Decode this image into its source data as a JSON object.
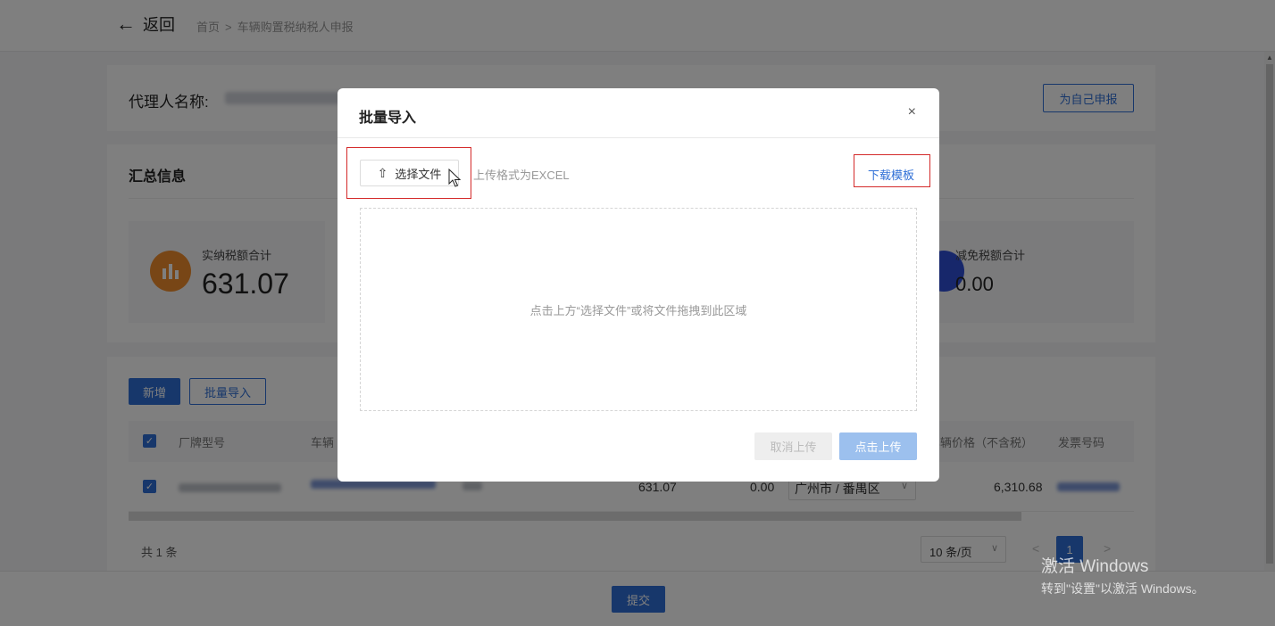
{
  "header": {
    "back_label": "返回",
    "breadcrumb": [
      "首页",
      "车辆购置税纳税人申报"
    ],
    "breadcrumb_sep": ">"
  },
  "agent": {
    "label": "代理人名称:",
    "self_report_button": "为自己申报"
  },
  "summary": {
    "title": "汇总信息",
    "stats": [
      {
        "label": "实纳税额合计",
        "value": "631.07",
        "icon": "bar-chart-icon",
        "color": "#f08c2c"
      },
      {
        "label": "减免税额合计",
        "value": "0.00",
        "icon": "circle-icon",
        "color": "#2f4ed6"
      }
    ]
  },
  "table": {
    "add_button": "新增",
    "import_button": "批量导入",
    "columns": [
      "厂牌型号",
      "车辆",
      "车辆价格（不含税）",
      "发票号码"
    ],
    "row": {
      "tax": "631.07",
      "relief": "0.00",
      "district": "广州市 / 番禺区",
      "price": "6,310.68"
    },
    "total_text": "共 1 条",
    "page_size": "10 条/页",
    "prev": "<",
    "next": ">",
    "current_page": "1"
  },
  "footer": {
    "submit_button": "提交"
  },
  "modal": {
    "title": "批量导入",
    "close": "×",
    "choose_file_button": "选择文件",
    "format_hint": "上传格式为EXCEL",
    "download_template": "下载模板",
    "dropzone_text": "点击上方“选择文件”或将文件拖拽到此区域",
    "cancel_upload": "取消上传",
    "upload": "点击上传"
  },
  "watermark": {
    "line1": "激活 Windows",
    "line2": "转到\"设置\"以激活 Windows。"
  },
  "colors": {
    "primary": "#2f6fd6",
    "highlight_box": "#d42a2a"
  }
}
